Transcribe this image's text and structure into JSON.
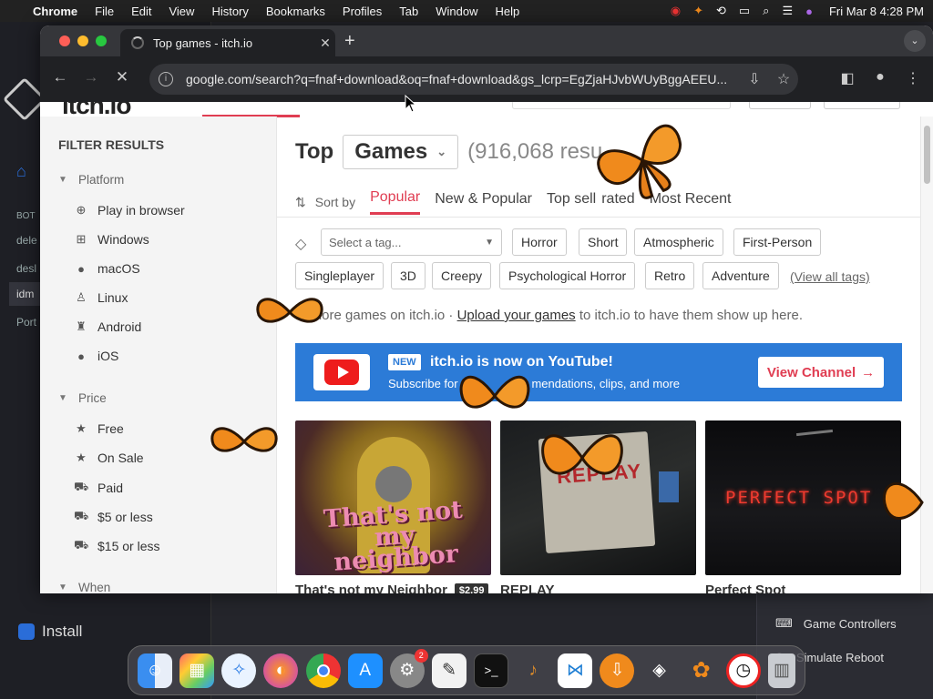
{
  "menubar": {
    "app_name": "Chrome",
    "items": [
      "File",
      "Edit",
      "View",
      "History",
      "Bookmarks",
      "Profiles",
      "Tab",
      "Window",
      "Help"
    ],
    "clock": "Fri Mar 8  4:28 PM"
  },
  "background_app": {
    "sidebar_labels": [
      "BOT",
      "dele",
      "desl",
      "idm",
      "Port"
    ],
    "install_label": "Install",
    "panel_rows": [
      "Game Controllers",
      "Simulate Reboot"
    ]
  },
  "browser": {
    "tab_title": "Top games - itch.io",
    "url": "google.com/search?q=fnaf+download&oq=fnaf+download&gs_lcrp=EgZjaHJvbWUyBggAEEU..."
  },
  "site": {
    "logo": "itch.io"
  },
  "filters": {
    "title": "FILTER RESULTS",
    "platform_label": "Platform",
    "platforms": [
      {
        "label": "Play in browser",
        "icon": "globe-icon"
      },
      {
        "label": "Windows",
        "icon": "windows-icon"
      },
      {
        "label": "macOS",
        "icon": "apple-icon"
      },
      {
        "label": "Linux",
        "icon": "linux-icon"
      },
      {
        "label": "Android",
        "icon": "android-icon"
      },
      {
        "label": "iOS",
        "icon": "apple-icon"
      }
    ],
    "price_label": "Price",
    "prices": [
      {
        "label": "Free",
        "icon": "star-icon"
      },
      {
        "label": "On Sale",
        "icon": "star-icon"
      },
      {
        "label": "Paid",
        "icon": "cart-icon"
      },
      {
        "label": "$5 or less",
        "icon": "cart-icon"
      },
      {
        "label": "$15 or less",
        "icon": "cart-icon"
      }
    ],
    "when_label": "When"
  },
  "browse": {
    "heading_top": "Top",
    "heading_category": "Games",
    "count": "(916,068 resu",
    "sort_label": "Sort by",
    "sort_options": [
      "Popular",
      "New & Popular",
      "Top sell",
      "rated",
      "Most Recent"
    ],
    "active_sort": "Popular",
    "tag_placeholder": "Select a tag...",
    "tags_row1": [
      "Horror",
      "Short",
      "Atmospheric",
      "First-Person"
    ],
    "tags_row2": [
      "Singleplayer",
      "3D",
      "Creepy",
      "Psychological Horror",
      "Retro",
      "Adventure"
    ],
    "view_all_tags": "(View all tags)",
    "explore_prefix": "Explore games on itch.io · ",
    "explore_link": "Upload your games",
    "explore_suffix": " to itch.io to have them show up here."
  },
  "youtube_banner": {
    "badge": "NEW",
    "headline": "itch.io is now on YouTube!",
    "subline_prefix": "Subscribe for g",
    "subline_suffix": "mendations, clips, and more",
    "button": "View Channel"
  },
  "games": [
    {
      "title": "That's not my Neighbor",
      "price": "$2.99",
      "art_text": "That's not my neighbor"
    },
    {
      "title": "REPLAY",
      "price": "",
      "art_text": "REPLAY"
    },
    {
      "title": "Perfect Spot",
      "price": "",
      "art_text": "PERFECT SPOT"
    }
  ],
  "dock": {
    "apps": [
      "finder-icon",
      "launchpad-icon",
      "safari-icon",
      "firefox-icon",
      "chrome-icon",
      "app-store-icon",
      "system-settings-icon",
      "textedit-icon",
      "terminal-icon",
      "guitar-icon",
      "vscode-icon",
      "download-icon",
      "app-icon",
      "butterfly-icon",
      "clock-icon",
      "trash-icon"
    ],
    "settings_badge": "2"
  },
  "colors": {
    "itch_red": "#e03d52",
    "youtube_blue": "#2c7bd7",
    "butterfly_orange": "#f08a1c"
  }
}
